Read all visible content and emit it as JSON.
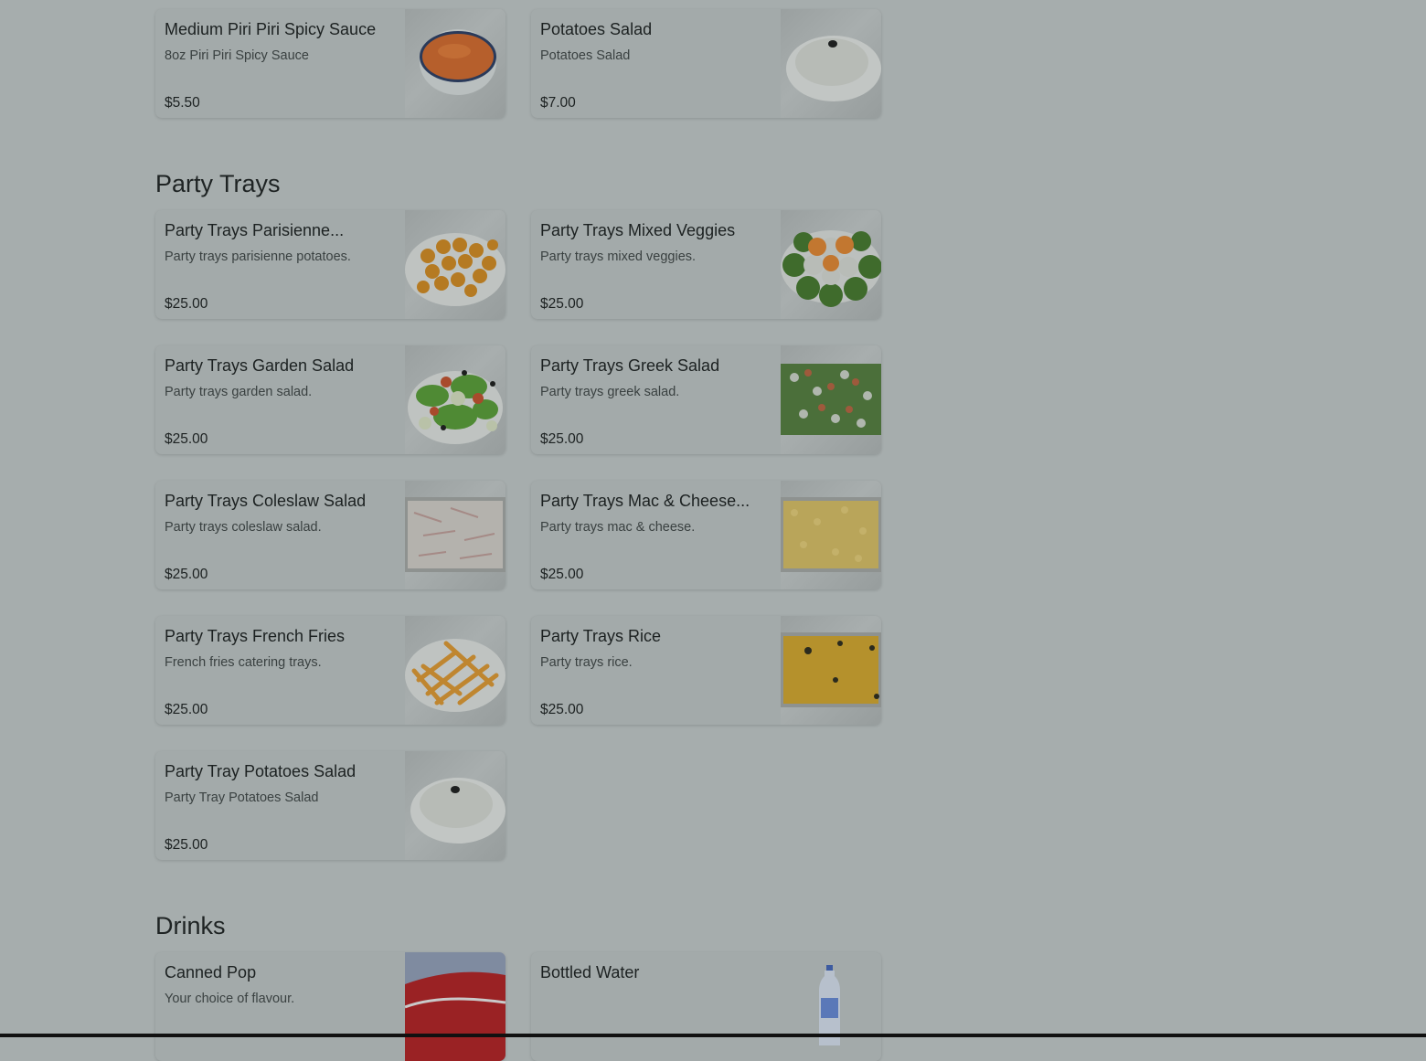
{
  "sections": {
    "sauces": {
      "items": [
        {
          "name": "Medium Piri Piri Spicy Sauce",
          "description": "8oz Piri Piri Spicy Sauce",
          "price": "$5.50",
          "image": "sauce-cup-image"
        },
        {
          "name": "Potatoes Salad",
          "description": "Potatoes Salad",
          "price": "$7.00",
          "image": "potato-salad-image"
        }
      ]
    },
    "party_trays": {
      "title": "Party Trays",
      "items": [
        {
          "name": "Party Trays Parisienne...",
          "description": "Party trays parisienne potatoes.",
          "price": "$25.00",
          "image": "parisienne-potatoes-image"
        },
        {
          "name": "Party Trays Mixed Veggies",
          "description": "Party trays mixed veggies.",
          "price": "$25.00",
          "image": "mixed-veggies-image"
        },
        {
          "name": "Party Trays Garden Salad",
          "description": "Party trays garden salad.",
          "price": "$25.00",
          "image": "garden-salad-image"
        },
        {
          "name": "Party Trays Greek Salad",
          "description": "Party trays greek salad.",
          "price": "$25.00",
          "image": "greek-salad-image"
        },
        {
          "name": "Party Trays Coleslaw Salad",
          "description": "Party trays coleslaw salad.",
          "price": "$25.00",
          "image": "coleslaw-image"
        },
        {
          "name": "Party Trays Mac & Cheese...",
          "description": "Party trays mac & cheese.",
          "price": "$25.00",
          "image": "mac-cheese-image"
        },
        {
          "name": "Party Trays French Fries",
          "description": "French fries catering trays.",
          "price": "$25.00",
          "image": "french-fries-image"
        },
        {
          "name": "Party Trays Rice",
          "description": "Party trays rice.",
          "price": "$25.00",
          "image": "rice-tray-image"
        },
        {
          "name": "Party Tray Potatoes Salad",
          "description": "Party Tray Potatoes Salad",
          "price": "$25.00",
          "image": "potato-salad-tray-image"
        }
      ]
    },
    "drinks": {
      "title": "Drinks",
      "items": [
        {
          "name": "Canned Pop",
          "description": "Your choice of flavour.",
          "image": "coca-cola-can-image"
        },
        {
          "name": "Bottled Water",
          "description": "",
          "image": "water-bottle-image"
        }
      ]
    }
  }
}
